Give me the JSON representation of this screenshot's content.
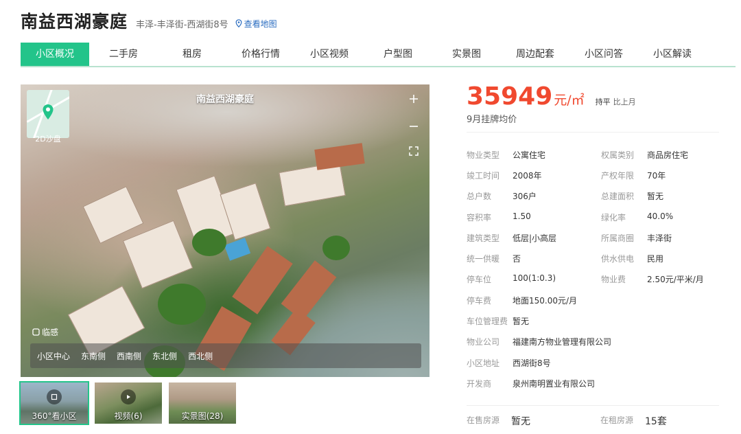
{
  "header": {
    "title": "南益西湖豪庭",
    "address": "丰泽-丰泽街-西湖街8号",
    "map_link": "查看地图"
  },
  "tabs": [
    {
      "label": "小区概况",
      "active": true
    },
    {
      "label": "二手房"
    },
    {
      "label": "租房"
    },
    {
      "label": "价格行情"
    },
    {
      "label": "小区视频"
    },
    {
      "label": "户型图"
    },
    {
      "label": "实景图"
    },
    {
      "label": "周边配套"
    },
    {
      "label": "小区问答"
    },
    {
      "label": "小区解读"
    }
  ],
  "photo": {
    "title": "南益西湖豪庭",
    "minimap_label": "2D沙盘",
    "vr_logo": "临感",
    "views": [
      "小区中心",
      "东南侧",
      "西南侧",
      "东北侧",
      "西北侧"
    ]
  },
  "thumbs": [
    {
      "label": "360°看小区",
      "icon": "cube-icon"
    },
    {
      "label": "视频(6)",
      "icon": "play-icon"
    },
    {
      "label": "实景图(28)",
      "icon": ""
    }
  ],
  "price": {
    "value": "35949",
    "unit": "元/㎡",
    "trend": "持平",
    "trend_label": "比上月",
    "subtitle": "9月挂牌均价"
  },
  "info": [
    [
      {
        "label": "物业类型",
        "value": "公寓住宅"
      },
      {
        "label": "权属类别",
        "value": "商品房住宅"
      }
    ],
    [
      {
        "label": "竣工时间",
        "value": "2008年"
      },
      {
        "label": "产权年限",
        "value": "70年"
      }
    ],
    [
      {
        "label": "总户数",
        "value": "306户"
      },
      {
        "label": "总建面积",
        "value": "暂无"
      }
    ],
    [
      {
        "label": "容积率",
        "value": "1.50"
      },
      {
        "label": "绿化率",
        "value": "40.0%"
      }
    ],
    [
      {
        "label": "建筑类型",
        "value": "低层|小高层"
      },
      {
        "label": "所属商圈",
        "value": "丰泽街"
      }
    ],
    [
      {
        "label": "统一供暖",
        "value": "否"
      },
      {
        "label": "供水供电",
        "value": "民用"
      }
    ],
    [
      {
        "label": "停车位",
        "value": "100(1:0.3)"
      },
      {
        "label": "物业费",
        "value": "2.50元/平米/月"
      }
    ],
    [
      {
        "label": "停车费",
        "value": "地面150.00元/月"
      }
    ],
    [
      {
        "label": "车位管理费",
        "value": "暂无"
      }
    ],
    [
      {
        "label": "物业公司",
        "value": "福建南方物业管理有限公司"
      }
    ],
    [
      {
        "label": "小区地址",
        "value": "西湖街8号"
      }
    ],
    [
      {
        "label": "开发商",
        "value": "泉州南明置业有限公司"
      }
    ]
  ],
  "listing": {
    "for_sale_label": "在售房源",
    "for_sale_value": "暂无",
    "for_rent_label": "在租房源",
    "for_rent_value": "15套"
  },
  "colors": {
    "accent": "#23c48a",
    "price": "#f0492f",
    "link": "#2a6cc0"
  }
}
